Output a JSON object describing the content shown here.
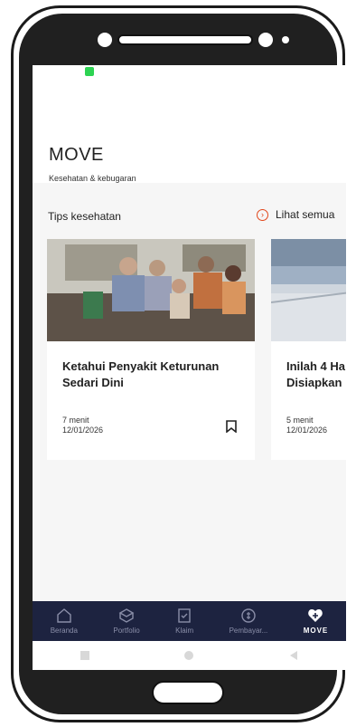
{
  "app": {
    "title": "MOVE",
    "subtitle": "Kesehatan & kebugaran"
  },
  "section": {
    "title": "Tips kesehatan",
    "see_all": "Lihat semua"
  },
  "cards": [
    {
      "title": "Ketahui Penyakit Keturunan Sedari Dini",
      "read_time": "7 menit",
      "date": "12/01/2026"
    },
    {
      "title": "Inilah 4 Ha Disiapkan",
      "read_time": "5 menit",
      "date": "12/01/2026"
    }
  ],
  "nav": {
    "items": [
      {
        "label": "Beranda",
        "icon": "home-icon"
      },
      {
        "label": "Portfolio",
        "icon": "portfolio-icon"
      },
      {
        "label": "Klaim",
        "icon": "claim-icon"
      },
      {
        "label": "Pembayar...",
        "icon": "payment-icon"
      },
      {
        "label": "MOVE",
        "icon": "move-heart-icon"
      }
    ]
  },
  "colors": {
    "accent": "#e2471b",
    "nav_bg": "#1d2340",
    "nav_inactive": "#8a8ea8",
    "nav_active": "#ffffff"
  }
}
